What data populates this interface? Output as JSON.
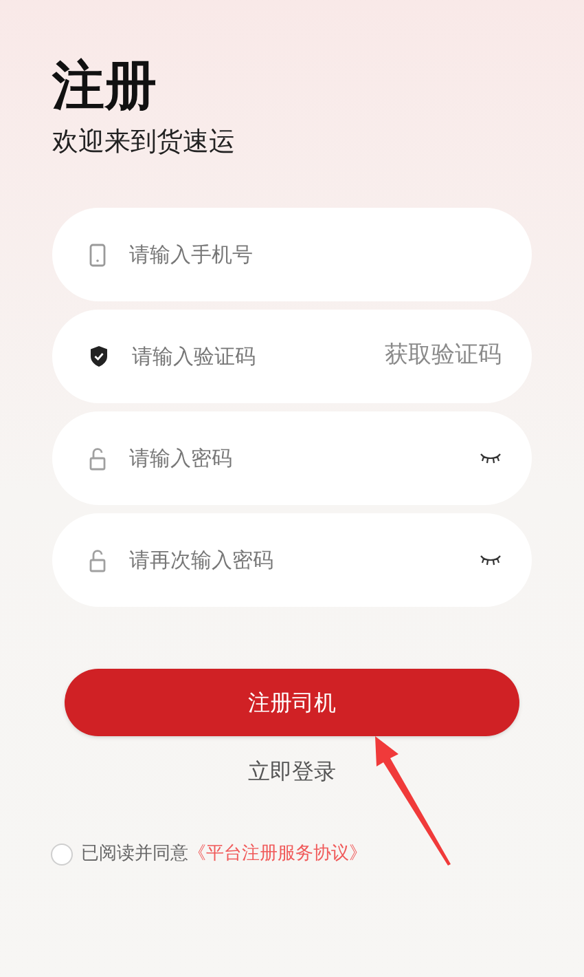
{
  "header": {
    "title": "注册",
    "subtitle": "欢迎来到货速运"
  },
  "fields": [
    {
      "kind": "phone",
      "placeholder": "请输入手机号"
    },
    {
      "kind": "code",
      "placeholder": "请输入验证码",
      "action": "获取验证码"
    },
    {
      "kind": "password",
      "placeholder": "请输入密码",
      "visible": false
    },
    {
      "kind": "password",
      "placeholder": "请再次输入密码",
      "visible": false
    }
  ],
  "submit": "注册司机",
  "login_link": "立即登录",
  "agreement": {
    "checked": false,
    "text": "已阅读并同意",
    "link": "《平台注册服务协议》"
  }
}
